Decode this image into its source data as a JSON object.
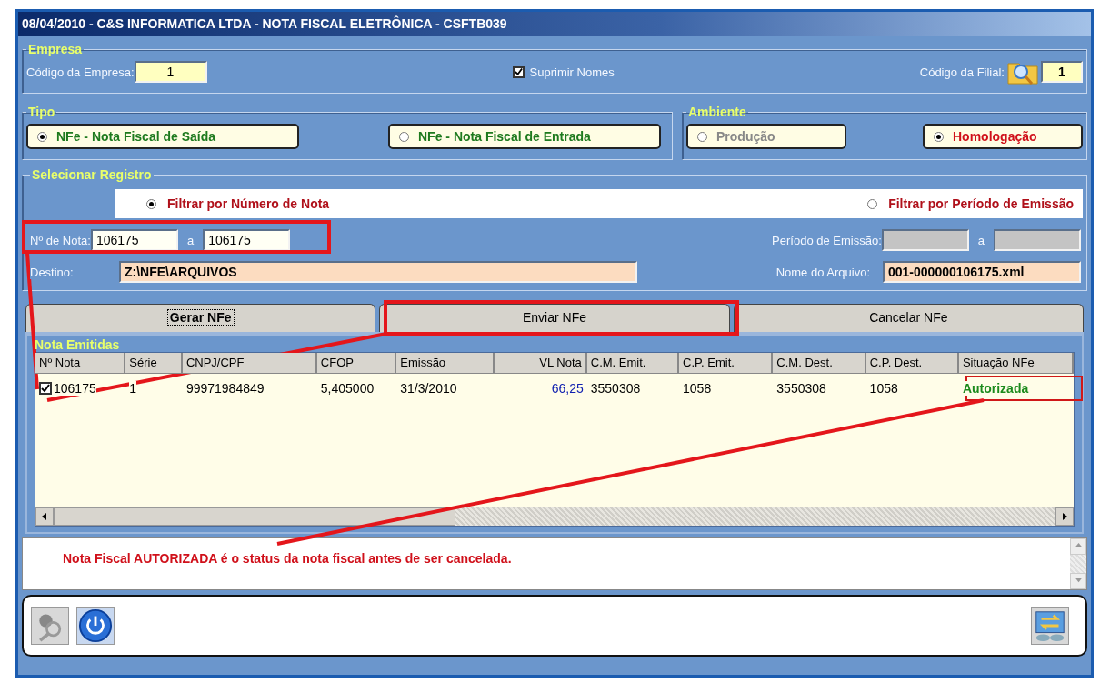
{
  "window": {
    "title": "08/04/2010 - C&S INFORMATICA LTDA - NOTA FISCAL ELETRÔNICA - CSFTB039"
  },
  "empresa": {
    "legend": "Empresa",
    "codigo_label": "Código da Empresa:",
    "codigo_value": "1",
    "suprimir": {
      "label": "Suprimir Nomes",
      "checked": true
    },
    "filial_label": "Código da Filial:",
    "filial_value": "1"
  },
  "tipo": {
    "legend": "Tipo",
    "options": [
      {
        "label": "NFe - Nota Fiscal de Saída",
        "selected": true,
        "disabled": false
      },
      {
        "label": "NFe - Nota Fiscal de Entrada",
        "selected": false,
        "disabled": false
      }
    ]
  },
  "ambiente": {
    "legend": "Ambiente",
    "options": [
      {
        "label": "Produção",
        "selected": false,
        "disabled": true
      },
      {
        "label": "Homologação",
        "selected": true,
        "disabled": false
      }
    ]
  },
  "registro": {
    "legend": "Selecionar Registro",
    "filters": [
      {
        "label": "Filtrar por Número de Nota",
        "selected": true
      },
      {
        "label": "Filtrar por Período de Emissão",
        "selected": false
      }
    ],
    "nota_label": "Nº de Nota:",
    "nota_from": "106175",
    "nota_sep": "a",
    "nota_to": "106175",
    "periodo_label": "Período de Emissão:",
    "periodo_sep": "a",
    "destino_label": "Destino:",
    "destino_value": "Z:\\NFE\\ARQUIVOS",
    "arquivo_label": "Nome do Arquivo:",
    "arquivo_value": "001-000000106175.xml"
  },
  "tabs": [
    {
      "label": "Gerar NFe",
      "selected": true
    },
    {
      "label": "Enviar NFe",
      "selected": false
    },
    {
      "label": "Cancelar NFe",
      "selected": false
    }
  ],
  "grid": {
    "legend": "Nota Emitidas",
    "columns": [
      {
        "label": "Nº Nota",
        "kind": "text"
      },
      {
        "label": "Série",
        "kind": "text"
      },
      {
        "label": "CNPJ/CPF",
        "kind": "text"
      },
      {
        "label": "CFOP",
        "kind": "text"
      },
      {
        "label": "Emissão",
        "kind": "text"
      },
      {
        "label": "VL Nota",
        "kind": "amount"
      },
      {
        "label": "C.M. Emit.",
        "kind": "text"
      },
      {
        "label": "C.P. Emit.",
        "kind": "text"
      },
      {
        "label": "C.M. Dest.",
        "kind": "text"
      },
      {
        "label": "C.P. Dest.",
        "kind": "text"
      },
      {
        "label": "Situação NFe",
        "kind": "status"
      }
    ],
    "rows": [
      {
        "checked": true,
        "cells": [
          "106175",
          "1",
          "99971984849",
          "5,405000",
          "31/3/2010",
          "66,25",
          "3550308",
          "1058",
          "3550308",
          "1058",
          "Autorizada"
        ]
      }
    ]
  },
  "note": "Nota Fiscal AUTORIZADA é o status da nota fiscal antes de ser cancelada."
}
